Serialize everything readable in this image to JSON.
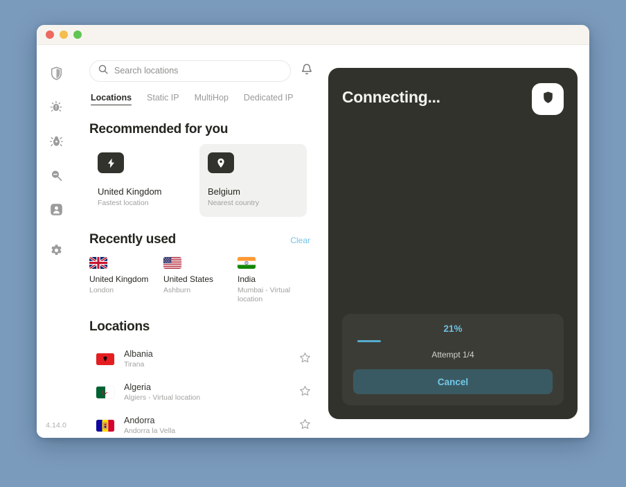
{
  "window": {
    "traffic_lights": [
      "close",
      "minimize",
      "maximize"
    ],
    "version": "4.14.0"
  },
  "sidebar": {
    "items": [
      {
        "name": "shield",
        "icon": "shield-icon",
        "label": "VPN"
      },
      {
        "name": "threat-alert",
        "icon": "threat-protection-alert-icon",
        "label": "Threat Protection"
      },
      {
        "name": "bug",
        "icon": "bug-icon",
        "label": "Malware"
      },
      {
        "name": "scan",
        "icon": "scan-search-icon",
        "label": "Scan"
      },
      {
        "name": "account",
        "icon": "person-badge-icon",
        "label": "Account"
      },
      {
        "name": "settings",
        "icon": "gear-icon",
        "label": "Settings"
      }
    ]
  },
  "search": {
    "placeholder": "Search locations",
    "icon": "search-icon"
  },
  "notifications": {
    "icon": "bell-icon"
  },
  "tabs": [
    {
      "label": "Locations",
      "active": true
    },
    {
      "label": "Static IP",
      "active": false
    },
    {
      "label": "MultiHop",
      "active": false
    },
    {
      "label": "Dedicated IP",
      "active": false
    }
  ],
  "recommended": {
    "title": "Recommended for you",
    "cards": [
      {
        "icon": "lightning-bolt-icon",
        "name": "United Kingdom",
        "subtitle": "Fastest location",
        "hover": false
      },
      {
        "icon": "map-pin-icon",
        "name": "Belgium",
        "subtitle": "Nearest country",
        "hover": true
      }
    ]
  },
  "recently_used": {
    "title": "Recently used",
    "clear_label": "Clear",
    "items": [
      {
        "flag": "gb",
        "name": "United Kingdom",
        "subtitle": "London"
      },
      {
        "flag": "us",
        "name": "United States",
        "subtitle": "Ashburn"
      },
      {
        "flag": "in",
        "name": "India",
        "subtitle": "Mumbai - Virtual location"
      }
    ]
  },
  "locations": {
    "title": "Locations",
    "rows": [
      {
        "flag": "al",
        "name": "Albania",
        "subtitle": "Tirana",
        "favorite_icon": "star-outline-icon"
      },
      {
        "flag": "dz",
        "name": "Algeria",
        "subtitle": "Algiers - Virtual location",
        "favorite_icon": "star-outline-icon"
      },
      {
        "flag": "ad",
        "name": "Andorra",
        "subtitle": "Andorra la Vella",
        "favorite_icon": "star-outline-icon"
      }
    ]
  },
  "connection_panel": {
    "title": "Connecting...",
    "logo_icon": "shield-logo-icon",
    "progress_percent": "21%",
    "progress_value": 21,
    "attempt": "Attempt 1/4",
    "cancel_label": "Cancel",
    "colors": {
      "panel_bg": "#32322c",
      "card_bg": "#3c3c36",
      "accent": "#6cc0e2",
      "cancel_bg": "#3a5a63"
    }
  }
}
